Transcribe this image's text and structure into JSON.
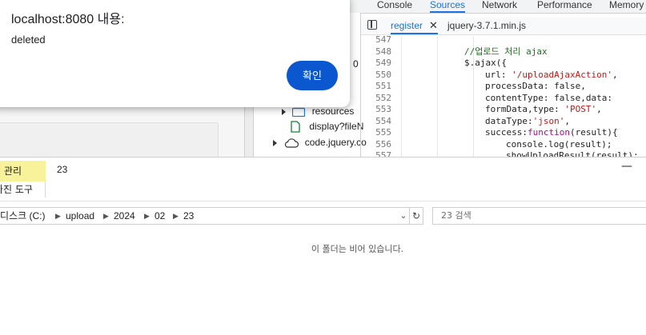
{
  "devtools": {
    "tabs": [
      "Console",
      "Sources",
      "Network",
      "Performance",
      "Memory"
    ],
    "active_tab": "Sources",
    "tree": [
      {
        "label": "resources"
      },
      {
        "label": "display?fileN"
      },
      {
        "label": "code.jquery.co"
      }
    ],
    "partial_number": "0",
    "editor_tabs": [
      {
        "label": "register"
      },
      {
        "label": "jquery-3.7.1.min.js"
      }
    ],
    "code_lines": [
      {
        "num": "547",
        "text": ""
      },
      {
        "num": "548",
        "text": "//업로드 처리 ajax"
      },
      {
        "num": "549",
        "text": "$.ajax({"
      },
      {
        "num": "550",
        "text": "url: '/uploadAjaxAction',"
      },
      {
        "num": "551",
        "text": "processData: false,"
      },
      {
        "num": "552",
        "text": "contentType: false,data:"
      },
      {
        "num": "553",
        "text": "formData,type: 'POST',"
      },
      {
        "num": "554",
        "text": "dataType:'json',"
      },
      {
        "num": "555",
        "text": "success:function(result){"
      },
      {
        "num": "556",
        "text": "console.log(result);"
      },
      {
        "num": "557",
        "text": "showUploadResult(result);"
      }
    ]
  },
  "alert": {
    "title": "localhost:8080 내용:",
    "message": "deleted",
    "ok_label": "확인"
  },
  "explorer": {
    "ribbon_manage": "관리",
    "ribbon_tool": "사진 도구",
    "title": "23",
    "minimize": "—",
    "breadcrumb": [
      "디스크 (C:)",
      "upload",
      "2024",
      "02",
      "23"
    ],
    "search_placeholder": "23 검색",
    "empty_message": "이 폴더는 비어 있습니다."
  },
  "colors": {
    "accent": "#1a73e8",
    "dialog_button": "#0b57d0",
    "ribbon_highlight": "#f8f29a"
  }
}
